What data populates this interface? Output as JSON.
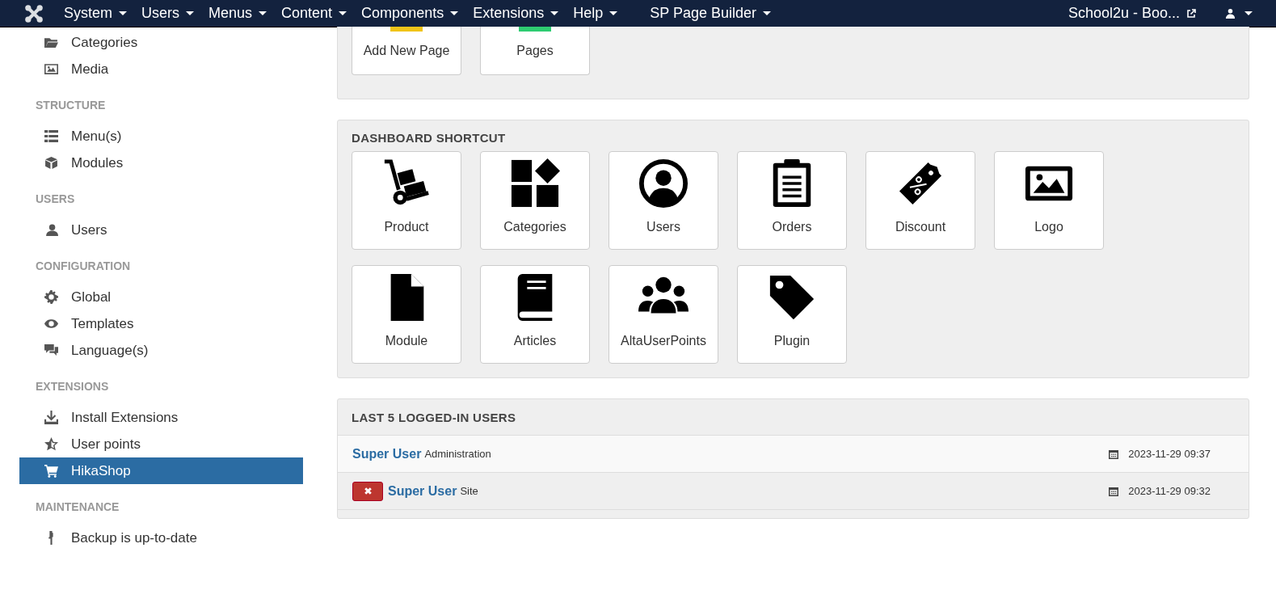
{
  "navbar": {
    "menus": [
      {
        "label": "System"
      },
      {
        "label": "Users"
      },
      {
        "label": "Menus"
      },
      {
        "label": "Content"
      },
      {
        "label": "Components"
      },
      {
        "label": "Extensions"
      },
      {
        "label": "Help"
      },
      {
        "label": "SP Page Builder"
      }
    ],
    "site_link": "School2u - Boo..."
  },
  "sidebar": {
    "sections": [
      {
        "items": [
          {
            "label": "Categories",
            "selected": false
          },
          {
            "label": "Media",
            "selected": false
          }
        ]
      },
      {
        "heading": "STRUCTURE",
        "items": [
          {
            "label": "Menu(s)",
            "selected": false
          },
          {
            "label": "Modules",
            "selected": false
          }
        ]
      },
      {
        "heading": "USERS",
        "items": [
          {
            "label": "Users",
            "selected": false
          }
        ]
      },
      {
        "heading": "CONFIGURATION",
        "items": [
          {
            "label": "Global",
            "selected": false
          },
          {
            "label": "Templates",
            "selected": false
          },
          {
            "label": "Language(s)",
            "selected": false
          }
        ]
      },
      {
        "heading": "EXTENSIONS",
        "items": [
          {
            "label": "Install Extensions",
            "selected": false
          },
          {
            "label": "User points",
            "selected": false
          },
          {
            "label": "HikaShop",
            "selected": true
          }
        ]
      },
      {
        "heading": "MAINTENANCE",
        "items": [
          {
            "label": "Backup is up-to-date",
            "selected": false
          }
        ]
      }
    ]
  },
  "page_builder_tiles": [
    {
      "label": "Add New Page"
    },
    {
      "label": "Pages"
    }
  ],
  "dashboard_shortcut": {
    "title": "DASHBOARD SHORTCUT",
    "tiles": [
      {
        "label": "Product"
      },
      {
        "label": "Categories"
      },
      {
        "label": "Users"
      },
      {
        "label": "Orders"
      },
      {
        "label": "Discount"
      },
      {
        "label": "Logo"
      },
      {
        "label": "Module"
      },
      {
        "label": "Articles"
      },
      {
        "label": "AltaUserPoints"
      },
      {
        "label": "Plugin"
      }
    ]
  },
  "logged_in_users": {
    "title": "LAST 5 LOGGED-IN USERS",
    "rows": [
      {
        "name": "Super User",
        "client": "Administration",
        "time": "2023-11-29 09:37",
        "logout_button": false
      },
      {
        "name": "Super User",
        "client": "Site",
        "time": "2023-11-29 09:32",
        "logout_button": true
      }
    ]
  }
}
